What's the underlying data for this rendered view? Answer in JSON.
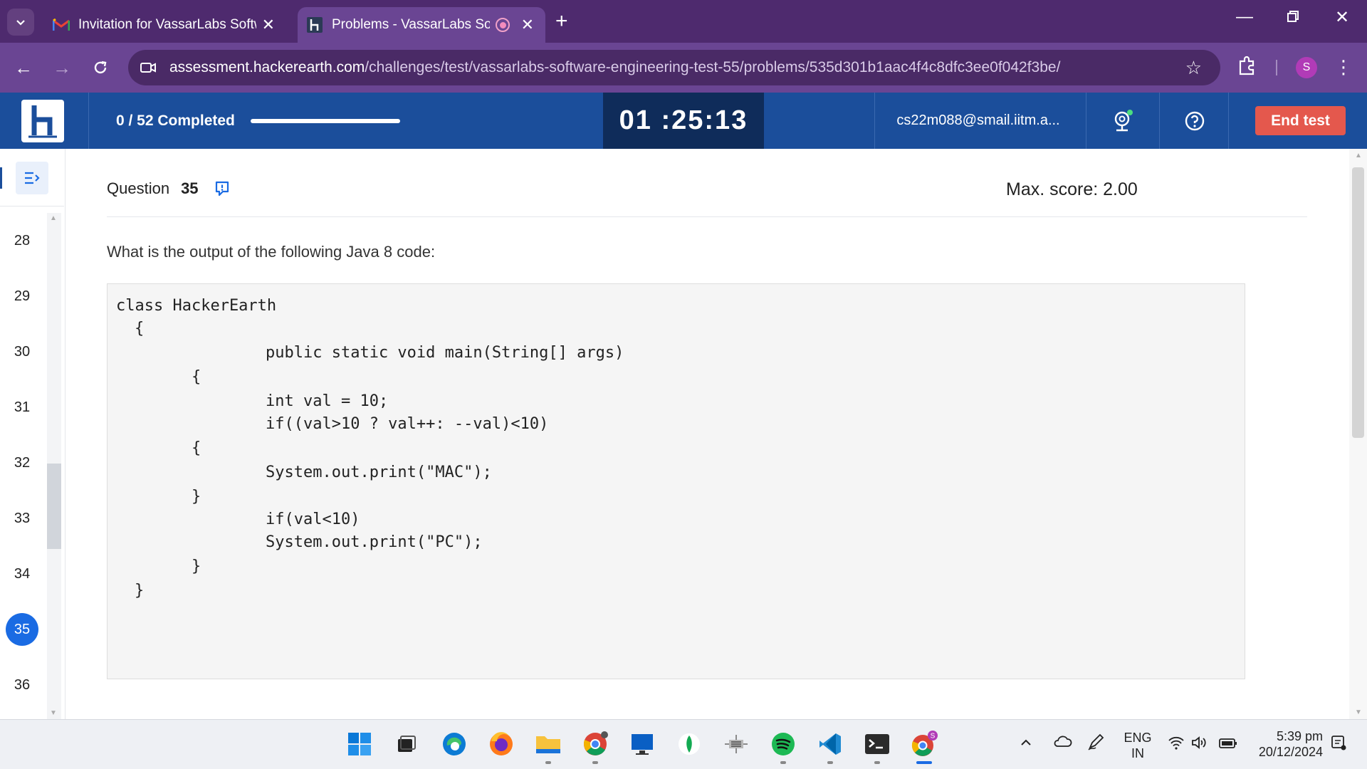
{
  "browser": {
    "tabs": [
      {
        "title": "Invitation for VassarLabs Softwa",
        "favicon": "gmail-icon",
        "active": false
      },
      {
        "title": "Problems - VassarLabs Softw",
        "favicon": "hackerearth-icon",
        "active": true,
        "recording": true
      }
    ],
    "url_host": "assessment.hackerearth.com",
    "url_path": "/challenges/test/vassarlabs-software-engineering-test-55/problems/535d301b1aac4f4c8dfc3ee0f042f3be/",
    "profile_initial": "S"
  },
  "header": {
    "progress_text": "0 / 52 Completed",
    "progress_fraction": 0,
    "timer": "01 :25:13",
    "email": "cs22m088@smail.iitm.a...",
    "end_test_label": "End test",
    "accent": "#1b4e9b",
    "end_test_color": "#e4584d"
  },
  "sidebar": {
    "questions": [
      "28",
      "29",
      "30",
      "31",
      "32",
      "33",
      "34",
      "35",
      "36"
    ],
    "current": "35"
  },
  "question": {
    "label": "Question",
    "number": "35",
    "max_score": "Max. score: 2.00",
    "prompt": "What is the output of the following Java 8 code:",
    "code_lines": [
      "class HackerEarth",
      "{",
      "public static void main(String[] args)",
      "{",
      "int val = 10;",
      "if((val>10 ? val++: --val)<10)",
      "{",
      "System.out.print(\"MAC\");",
      "}",
      "if(val<10)",
      "System.out.print(\"PC\");",
      "}",
      "}"
    ]
  },
  "taskbar": {
    "apps": [
      "windows-start-icon",
      "task-view-icon",
      "edge-icon",
      "firefox-icon",
      "file-explorer-icon",
      "chrome-icon",
      "remote-desktop-icon",
      "mongodb-icon",
      "network-icon",
      "spotify-icon",
      "vscode-icon",
      "terminal-icon",
      "chrome-profile-icon"
    ],
    "language_line1": "ENG",
    "language_line2": "IN",
    "time": "5:39 pm",
    "date": "20/12/2024"
  }
}
